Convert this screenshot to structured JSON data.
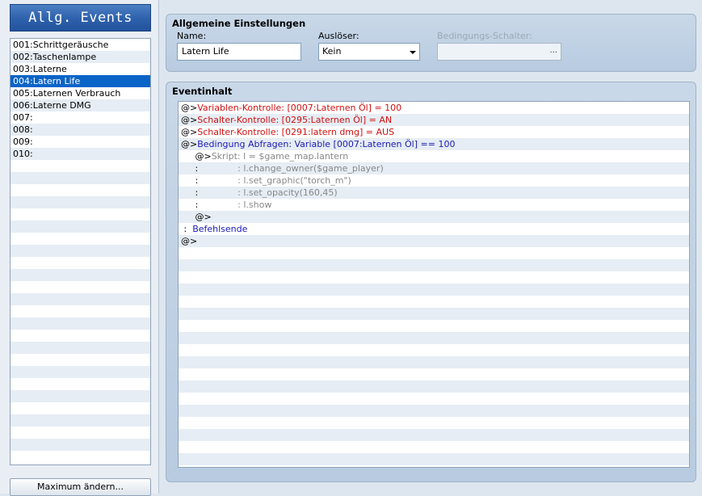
{
  "sidebar": {
    "title": "Allg. Events",
    "events": [
      {
        "label": "001:Schrittgeräusche",
        "selected": false
      },
      {
        "label": "002:Taschenlampe",
        "selected": false
      },
      {
        "label": "003:Laterne",
        "selected": false
      },
      {
        "label": "004:Latern Life",
        "selected": true
      },
      {
        "label": "005:Laternen Verbrauch",
        "selected": false
      },
      {
        "label": "006:Laterne DMG",
        "selected": false
      },
      {
        "label": "007:",
        "selected": false
      },
      {
        "label": "008:",
        "selected": false
      },
      {
        "label": "009:",
        "selected": false
      },
      {
        "label": "010:",
        "selected": false
      }
    ],
    "max_button_label": "Maximum ändern...",
    "selected_color": "#0a64c8"
  },
  "settings": {
    "title": "Allgemeine Einstellungen",
    "name_label": "Name:",
    "name_value": "Latern Life",
    "trigger_label": "Auslöser:",
    "trigger_value": "Kein",
    "switch_label": "Bedingungs-Schalter:",
    "switch_button": "..."
  },
  "content": {
    "title": "Eventinhalt",
    "commands": [
      {
        "segments": [
          {
            "text": "@>",
            "color": "black"
          },
          {
            "text": "Variablen-Kontrolle: [0007:Laternen Öl] = 100",
            "color": "red"
          }
        ]
      },
      {
        "segments": [
          {
            "text": "@>",
            "color": "black"
          },
          {
            "text": "Schalter-Kontrolle: [0295:Laternen Öl] = AN",
            "color": "red"
          }
        ]
      },
      {
        "segments": [
          {
            "text": "@>",
            "color": "black"
          },
          {
            "text": "Schalter-Kontrolle: [0291:latern dmg] = AUS",
            "color": "red"
          }
        ]
      },
      {
        "segments": [
          {
            "text": "@>",
            "color": "black"
          },
          {
            "text": "Bedingung Abfragen: Variable [0007:Laternen Öl] == 100",
            "color": "blue"
          }
        ]
      },
      {
        "segments": [
          {
            "text": "     @>",
            "color": "black"
          },
          {
            "text": "Skript: l = $game_map.lantern",
            "color": "gray"
          }
        ]
      },
      {
        "segments": [
          {
            "text": "     :       ",
            "color": "black"
          },
          {
            "text": "       : l.change_owner($game_player)",
            "color": "gray"
          }
        ]
      },
      {
        "segments": [
          {
            "text": "     :       ",
            "color": "black"
          },
          {
            "text": "       : l.set_graphic(\"torch_m\")",
            "color": "gray"
          }
        ]
      },
      {
        "segments": [
          {
            "text": "     :       ",
            "color": "black"
          },
          {
            "text": "       : l.set_opacity(160,45)",
            "color": "gray"
          }
        ]
      },
      {
        "segments": [
          {
            "text": "     :       ",
            "color": "black"
          },
          {
            "text": "       : l.show",
            "color": "gray"
          }
        ]
      },
      {
        "segments": [
          {
            "text": "     @>",
            "color": "black"
          }
        ]
      },
      {
        "segments": [
          {
            "text": " :  ",
            "color": "black"
          },
          {
            "text": "Befehlsende",
            "color": "blue"
          }
        ]
      },
      {
        "segments": [
          {
            "text": "@>",
            "color": "black"
          }
        ]
      }
    ]
  }
}
